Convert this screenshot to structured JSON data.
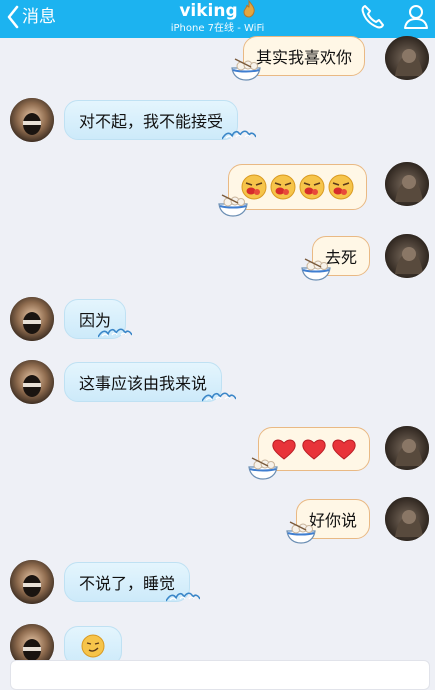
{
  "header": {
    "back_label": "消息",
    "title": "viking",
    "subtitle": "iPhone 7在线 - WiFi",
    "title_badge_icon": "flame-icon",
    "call_icon": "phone-icon",
    "profile_icon": "user-icon",
    "bg_color": "#1cb3f0"
  },
  "messages": [
    {
      "side": "out",
      "text": "其实我喜欢你"
    },
    {
      "side": "in",
      "text": "对不起，我不能接受"
    },
    {
      "side": "out",
      "content": "emoji",
      "emoji": [
        "red-nose-face-icon",
        "red-nose-face-icon",
        "red-nose-face-icon",
        "red-nose-face-icon"
      ]
    },
    {
      "side": "out",
      "text": "去死"
    },
    {
      "side": "in",
      "text": "因为"
    },
    {
      "side": "in",
      "text": "这事应该由我来说"
    },
    {
      "side": "out",
      "content": "emoji",
      "emoji": [
        "heart-icon",
        "heart-icon",
        "heart-icon"
      ]
    },
    {
      "side": "out",
      "text": "好你说"
    },
    {
      "side": "in",
      "text": "不说了，睡觉"
    },
    {
      "side": "in",
      "content": "emoji",
      "emoji": [
        "smirk-face-icon"
      ]
    }
  ],
  "colors": {
    "incoming_bubble": "#cdeafa",
    "outgoing_bubble": "#fff7e6",
    "outgoing_border": "#e9b984",
    "background": "#eef0f6"
  }
}
